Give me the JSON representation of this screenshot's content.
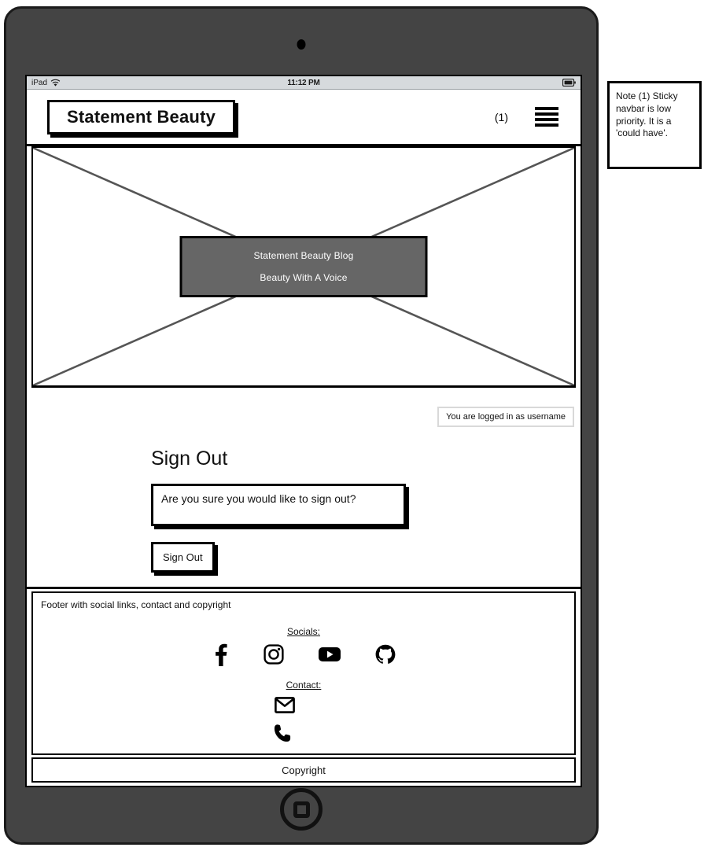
{
  "device": {
    "status_bar": {
      "carrier_label": "iPad",
      "wifi_icon": "wifi-icon",
      "time": "11:12 PM",
      "battery_icon": "battery-icon"
    },
    "camera_icon": "front-camera-icon",
    "home_button_icon": "home-button-icon"
  },
  "navbar": {
    "brand": "Statement Beauty",
    "note_ref": "(1)",
    "menu_icon": "hamburger-menu-icon"
  },
  "hero": {
    "placeholder_icon": "image-placeholder-icon",
    "title": "Statement Beauty Blog",
    "subtitle": "Beauty With A Voice",
    "overlay_color": "#666666"
  },
  "main": {
    "login_status": "You are logged in as username",
    "heading": "Sign Out",
    "confirm_message": "Are you sure you would like to sign out?",
    "signout_button_label": "Sign Out"
  },
  "footer": {
    "description": "Footer with social links, contact and copyright",
    "socials_label": "Socials:",
    "socials": [
      {
        "name": "facebook-icon",
        "label": "Facebook"
      },
      {
        "name": "instagram-icon",
        "label": "Instagram"
      },
      {
        "name": "youtube-icon",
        "label": "YouTube"
      },
      {
        "name": "github-icon",
        "label": "GitHub"
      }
    ],
    "contact_label": "Contact:",
    "contacts": [
      {
        "name": "email-icon",
        "label": "Email"
      },
      {
        "name": "phone-icon",
        "label": "Phone"
      }
    ],
    "copyright": "Copyright"
  },
  "annotation": {
    "note": "Note (1) Sticky navbar is low priority. It is a 'could have'."
  }
}
